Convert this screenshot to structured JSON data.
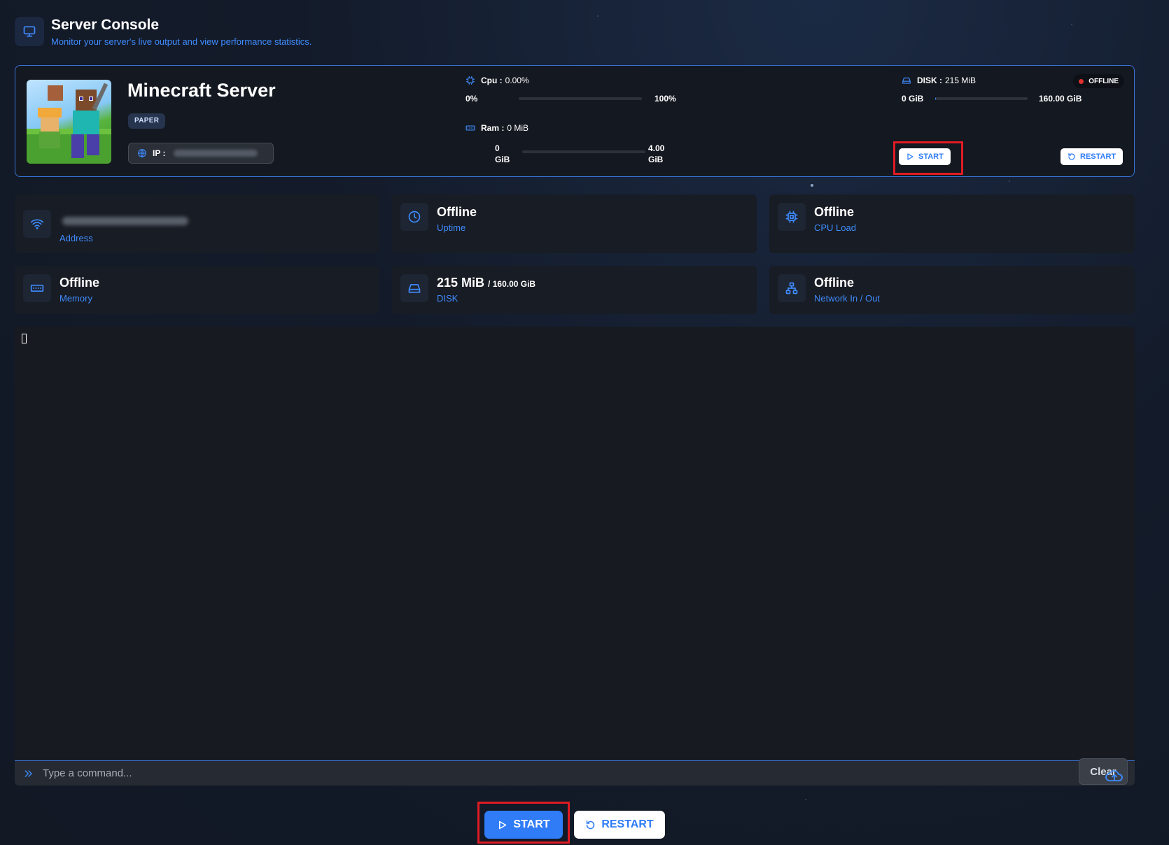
{
  "header": {
    "title": "Server Console",
    "subtitle": "Monitor your server's live output and view performance statistics."
  },
  "server": {
    "name": "Minecraft Server",
    "tag": "PAPER",
    "ip_label": "IP :",
    "status": "OFFLINE",
    "status_color": "#e03131",
    "cpu": {
      "label": "Cpu :",
      "value": "0.00%",
      "min": "0%",
      "max": "100%",
      "fraction": 0.0
    },
    "ram": {
      "label": "Ram :",
      "value": "0 MiB",
      "min": "0 GiB",
      "max": "4.00 GiB",
      "fraction": 0.0
    },
    "disk": {
      "label": "DISK :",
      "value": "215 MiB",
      "min": "0 GiB",
      "max": "160.00 GiB",
      "fraction": 0.0013
    },
    "start_label": "START",
    "restart_label": "RESTART"
  },
  "tiles": {
    "address": {
      "label": "Address"
    },
    "uptime": {
      "value": "Offline",
      "label": "Uptime"
    },
    "cpu_load": {
      "value": "Offline",
      "label": "CPU Load"
    },
    "memory": {
      "value": "Offline",
      "label": "Memory"
    },
    "disk": {
      "value": "215 MiB",
      "total": "/ 160.00 GiB",
      "label": "DISK"
    },
    "network": {
      "value": "Offline",
      "label": "Network In / Out"
    }
  },
  "console": {
    "placeholder": "Type a command...",
    "clear_label": "Clear"
  },
  "actions": {
    "start_label": "START",
    "restart_label": "RESTART"
  },
  "colors": {
    "accent": "#3f8cff",
    "primary_button": "#2f7cf6",
    "highlight": "#e01b24",
    "card_border": "#3a74d9"
  },
  "icons": {
    "header": "monitor-icon",
    "ip": "globe-icon",
    "cpu": "cpu-chip-icon",
    "ram": "memory-icon",
    "disk": "hard-drive-icon",
    "address": "wifi-icon",
    "uptime": "clock-icon",
    "network": "network-icon",
    "start": "play-icon",
    "restart": "restart-icon",
    "command": "chevrons-right-icon",
    "upload": "cloud-upload-icon"
  }
}
